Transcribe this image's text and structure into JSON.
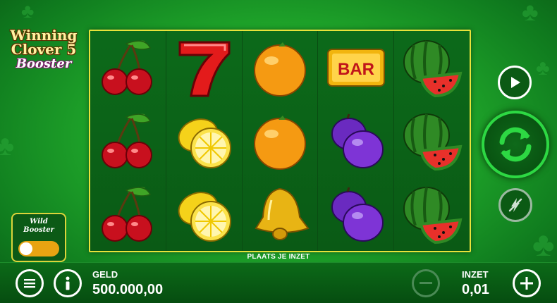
{
  "game": {
    "title_line1": "Winning",
    "title_line2": "Clover 5",
    "title_line3": "Booster"
  },
  "reels": [
    [
      "cherry",
      "cherry",
      "cherry"
    ],
    [
      "seven",
      "lemon",
      "lemon"
    ],
    [
      "orange",
      "orange",
      "bell"
    ],
    [
      "bar",
      "plum",
      "plum"
    ],
    [
      "watermelon",
      "watermelon",
      "watermelon"
    ]
  ],
  "bar_symbol_text": "BAR",
  "bet_hint": "PLAATS JE INZET",
  "wild_booster": {
    "label_line1": "Wild",
    "label_line2": "Booster",
    "enabled": false
  },
  "controls": {
    "play_icon": "play-icon",
    "spin_icon": "spin-refresh-icon",
    "turbo_icon": "lightning-disabled-icon",
    "menu_icon": "hamburger-menu-icon",
    "info_icon": "info-icon",
    "minus_icon": "minus-icon",
    "plus_icon": "plus-icon"
  },
  "balance": {
    "label": "GELD",
    "value": "500.000,00"
  },
  "bet": {
    "label": "INZET",
    "value": "0,01"
  },
  "colors": {
    "frame": "#e8e23a",
    "accent_green": "#2dd843",
    "toggle": "#e8a412"
  }
}
